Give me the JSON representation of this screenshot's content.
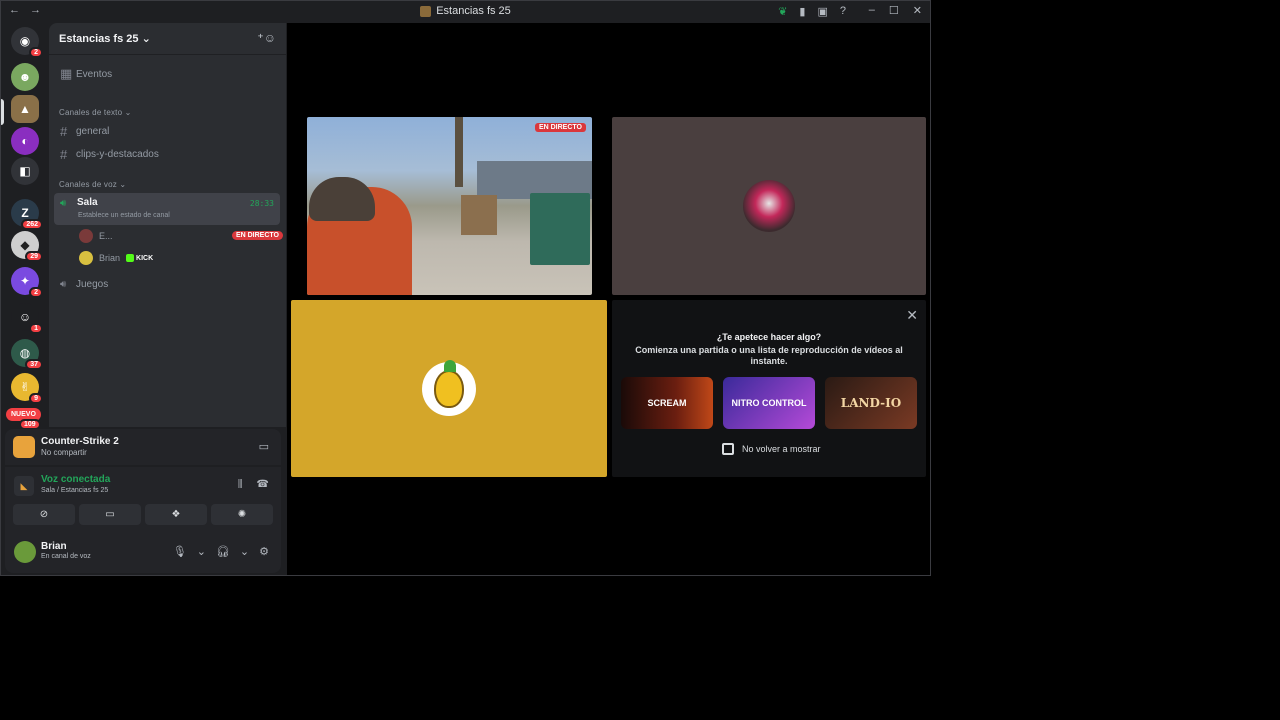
{
  "window": {
    "title": "Estancias fs 25"
  },
  "guild": {
    "name": "Estancias fs 25"
  },
  "channels": {
    "events_label": "Eventos",
    "text_category": "Canales de texto",
    "text_channels": [
      "general",
      "clips-y-destacados"
    ],
    "voice_category": "Canales de voz",
    "active_voice": {
      "name": "Sala",
      "status": "Establece un estado de canal",
      "timer": "28:33"
    },
    "members": [
      {
        "name": "E...",
        "badge": "EN DIRECTO"
      },
      {
        "name": "Brian",
        "tag": "KICK"
      }
    ],
    "other_voice": "Juegos"
  },
  "rail": {
    "badges": [
      "2",
      "262",
      "29",
      "2",
      "1",
      "37",
      "9",
      "109"
    ],
    "new_label": "NUEVO"
  },
  "activity": {
    "game": "Counter-Strike 2",
    "sub": "No compartir"
  },
  "voice": {
    "status": "Voz conectada",
    "location": "Sala / Estancias fs 25"
  },
  "user": {
    "name": "Brian",
    "status": "En canal de voz"
  },
  "stage": {
    "live_label": "EN DIRECTO",
    "prompt_title": "¿Te apetece hacer algo?",
    "prompt_desc": "Comienza una partida o una lista de reproducción de vídeos al instante.",
    "games": [
      "SCREAM",
      "NITRO CONTROL",
      "LAND-IO"
    ],
    "dont_show": "No volver a mostrar"
  },
  "colors": {
    "accent_green": "#23a55a",
    "live_red": "#da373c",
    "bg": "#1e1f22"
  }
}
